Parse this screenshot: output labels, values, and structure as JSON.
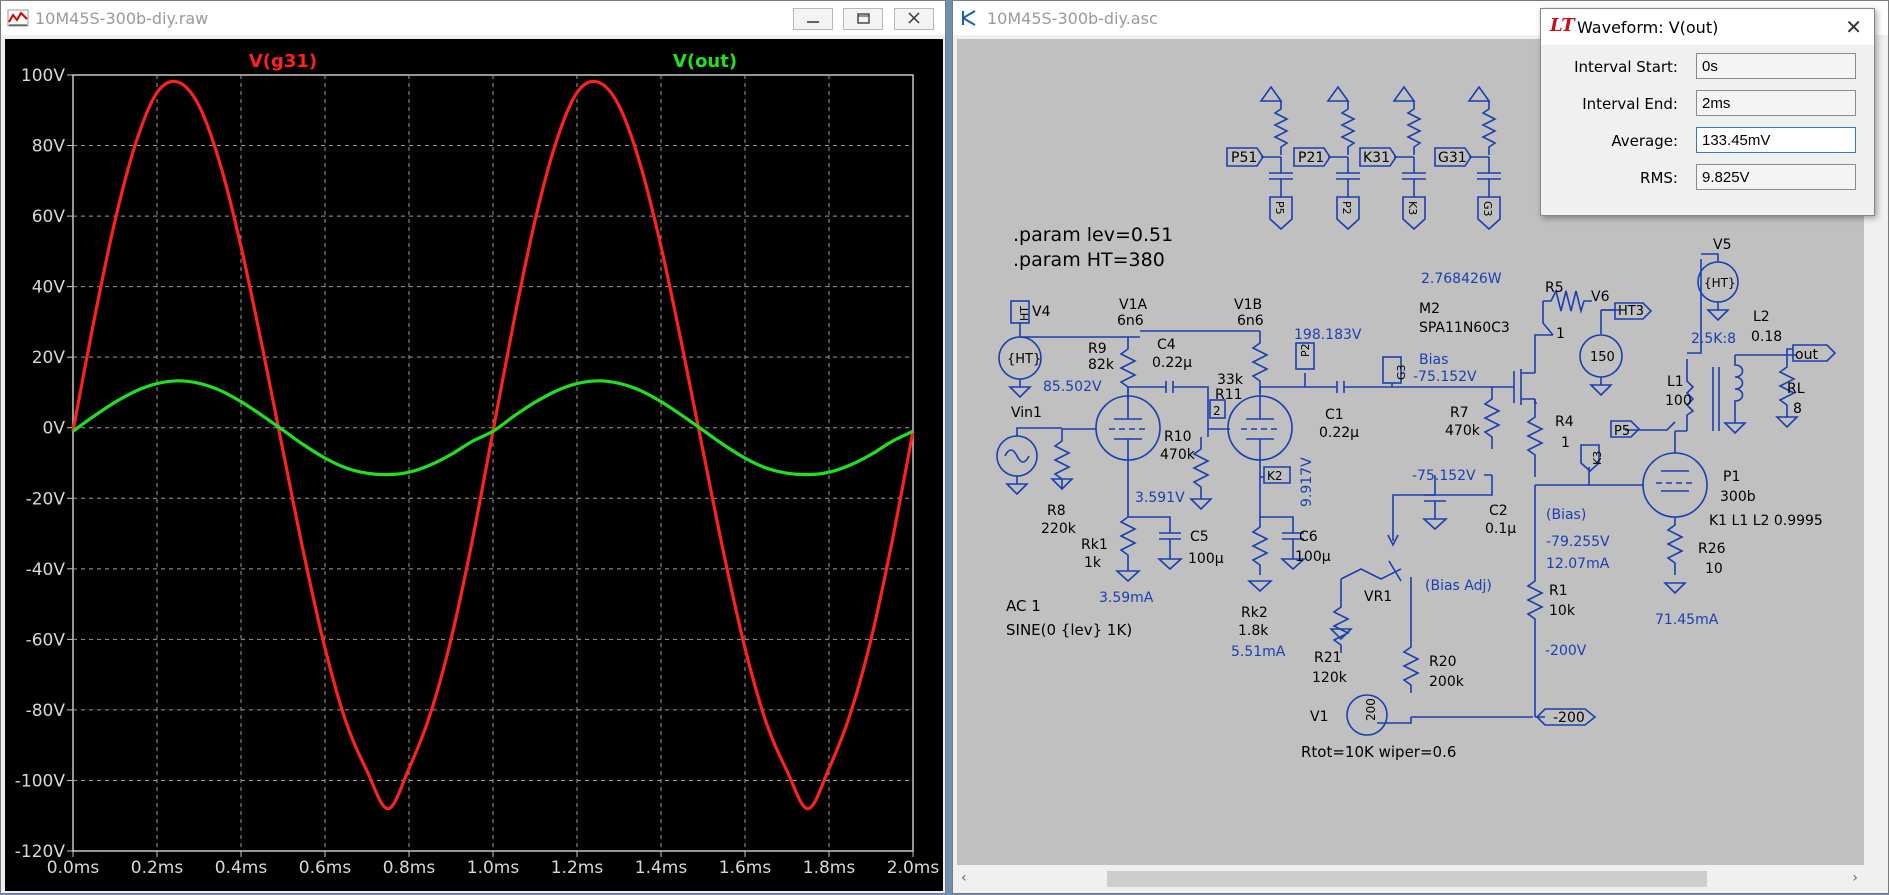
{
  "plot_window": {
    "title": "10M45S-300b-diy.raw",
    "buttons": {
      "minimize": "—",
      "restore": "☐",
      "close": "✕"
    }
  },
  "schematic_window": {
    "title": "10M45S-300b-diy.asc"
  },
  "waveform_dialog": {
    "title": "Waveform: V(out)",
    "close": "✕",
    "fields": [
      {
        "label": "Interval Start:",
        "value": "0s"
      },
      {
        "label": "Interval End:",
        "value": "2ms"
      },
      {
        "label": "Average:",
        "value": "133.45mV"
      },
      {
        "label": "RMS:",
        "value": "9.825V"
      }
    ]
  },
  "chart_data": {
    "type": "line",
    "x_ticks": [
      "0.0ms",
      "0.2ms",
      "0.4ms",
      "0.6ms",
      "0.8ms",
      "1.0ms",
      "1.2ms",
      "1.4ms",
      "1.6ms",
      "1.8ms",
      "2.0ms"
    ],
    "y_ticks": [
      "100V",
      "80V",
      "60V",
      "40V",
      "20V",
      "0V",
      "-20V",
      "-40V",
      "-60V",
      "-80V",
      "-100V",
      "-120V"
    ],
    "xlim": [
      0,
      2
    ],
    "ylim": [
      -120,
      100
    ],
    "grid": true,
    "series": [
      {
        "name": "V(g31)",
        "color": "#ff2020",
        "x": [
          0,
          0.05,
          0.1,
          0.15,
          0.2,
          0.25,
          0.3,
          0.35,
          0.4,
          0.45,
          0.5,
          0.55,
          0.6,
          0.65,
          0.7,
          0.75,
          0.8,
          0.85,
          0.9,
          0.95,
          1.0,
          1.05,
          1.1,
          1.15,
          1.2,
          1.25,
          1.3,
          1.35,
          1.4,
          1.45,
          1.5,
          1.55,
          1.6,
          1.65,
          1.7,
          1.75,
          1.8,
          1.85,
          1.9,
          1.95,
          2.0
        ],
        "values": [
          -1,
          30.4,
          58.7,
          80.9,
          95,
          98,
          91.3,
          74.9,
          51.4,
          23.3,
          -6.5,
          -36,
          -62.5,
          -83.4,
          -97.3,
          -108,
          -96.6,
          -81.4,
          -60,
          -32.4,
          -1,
          30.4,
          58.7,
          80.9,
          95,
          98,
          91.3,
          74.9,
          51.4,
          23.3,
          -6.5,
          -36,
          -62.5,
          -83.4,
          -97.3,
          -108,
          -96.6,
          -81.4,
          -60,
          -32.4,
          -1
        ]
      },
      {
        "name": "V(out)",
        "color": "#20e020",
        "x": [
          0,
          0.05,
          0.1,
          0.15,
          0.2,
          0.25,
          0.3,
          0.35,
          0.4,
          0.45,
          0.5,
          0.55,
          0.6,
          0.65,
          0.7,
          0.75,
          0.8,
          0.85,
          0.9,
          0.95,
          1.0,
          1.05,
          1.1,
          1.15,
          1.2,
          1.25,
          1.3,
          1.35,
          1.4,
          1.45,
          1.5,
          1.55,
          1.6,
          1.65,
          1.7,
          1.75,
          1.8,
          1.85,
          1.9,
          1.95,
          2.0
        ],
        "values": [
          -1,
          3.3,
          7.2,
          10.4,
          12.5,
          13.3,
          12.6,
          10.6,
          7.4,
          3.5,
          -0.7,
          -4.9,
          -8.6,
          -11.4,
          -12.9,
          -13.3,
          -12.6,
          -10.6,
          -7.6,
          -3.9,
          -1,
          3.3,
          7.2,
          10.4,
          12.5,
          13.3,
          12.6,
          10.6,
          7.4,
          3.5,
          -0.7,
          -4.9,
          -8.6,
          -11.4,
          -12.9,
          -13.3,
          -12.6,
          -10.6,
          -7.6,
          -3.9,
          -1
        ]
      }
    ]
  },
  "schematic": {
    "directives": [
      ".param lev=0.51",
      ".param HT=380"
    ],
    "source_text": [
      "AC 1",
      "SINE(0 {lev} 1K)"
    ],
    "pot_text": "Rtot=10K wiper=0.6",
    "net_labels": [
      "P51",
      "P21",
      "K31",
      "G31",
      "P5",
      "P2",
      "K3",
      "G3",
      "HT",
      "HT3",
      "out",
      "P5",
      "K3",
      "-200",
      "G3",
      "P2",
      "2",
      "K2"
    ],
    "components": {
      "V4": "V4",
      "V1A": "V1A",
      "V1A_v": "6n6",
      "V1B": "V1B",
      "V1B_v": "6n6",
      "R9": "R9",
      "R9_v": "82k",
      "C4": "C4",
      "C4_v": "0.22µ",
      "R11": "R11",
      "R11_v": "33k",
      "Vin1": "Vin1",
      "R10": "R10",
      "R10_v": "470k",
      "R8": "R8",
      "R8_v": "220k",
      "Rk1": "Rk1",
      "Rk1_v": "1k",
      "C5": "C5",
      "C5_v": "100µ",
      "C6": "C6",
      "C6_v": "100µ",
      "Rk2": "Rk2",
      "Rk2_v": "1.8k",
      "C1": "C1",
      "C1_v": "0.22µ",
      "R7": "R7",
      "R7_v": "470k",
      "C2": "C2",
      "C2_v": "0.1µ",
      "VR1": "VR1",
      "R21": "R21",
      "R21_v": "120k",
      "R20": "R20",
      "R20_v": "200k",
      "V1": "V1",
      "V1_v": "200",
      "M2": "M2",
      "M2_v": "SPA11N60C3",
      "R5": "R5",
      "R5_v": "1",
      "V6": "V6",
      "V6_v": "150",
      "R4": "R4",
      "R4_v": "1",
      "R1": "R1",
      "R1_v": "10k",
      "V5": "V5",
      "V5_v": "{HT}",
      "L1": "L1",
      "L1_v": "100",
      "L2": "L2",
      "L2_v": "0.18",
      "ratio": "2.5K:8",
      "RL": "RL",
      "RL_v": "8",
      "P1": "P1",
      "P1_v": "300b",
      "K1": "K1 L1 L2 0.9995",
      "R26": "R26",
      "R26_v": "10",
      "HT_src": "{HT}"
    },
    "annotations": {
      "power": "2.768426W",
      "v198": "198.183V",
      "bias": "Bias",
      "vbias1": "-75.152V",
      "v85": "85.502V",
      "v3591": "3.591V",
      "i359": "3.59mA",
      "i551": "5.51mA",
      "v9917": "9.917V",
      "vbias2": "-75.152V",
      "bias_adj": "(Bias Adj)",
      "bias_p": "(Bias)",
      "v79": "-79.255V",
      "i1207": "12.07mA",
      "v200": "-200V",
      "i7145": "71.45mA"
    }
  }
}
